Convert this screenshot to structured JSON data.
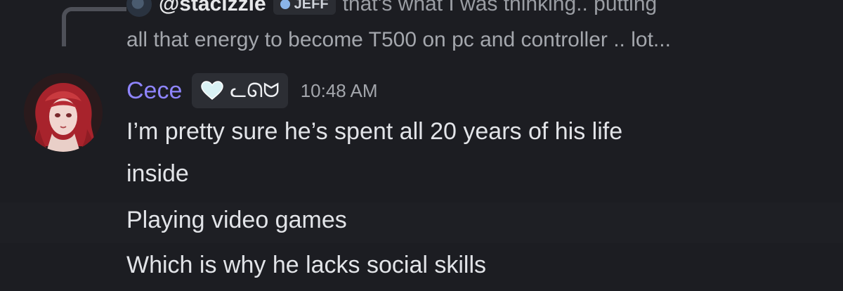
{
  "reply": {
    "author": "@stacizzle",
    "tag": "JEFF",
    "snippet_line1": "that's what I was thinking.. putting",
    "snippet_line2": "all that energy to become T500 on pc and controller .. lot..."
  },
  "message": {
    "author": "Cece",
    "tag": "ᓚᘏᗢ",
    "timestamp": "10:48 AM",
    "lines": [
      "I’m pretty sure he’s spent all 20 years of his life",
      "inside",
      "Playing video games",
      "Which is why he lacks social skills"
    ]
  },
  "colors": {
    "background": "#1c1d22",
    "author_name": "#8f85ff",
    "text": "#e2e4e8",
    "muted": "#a3a6ac"
  }
}
